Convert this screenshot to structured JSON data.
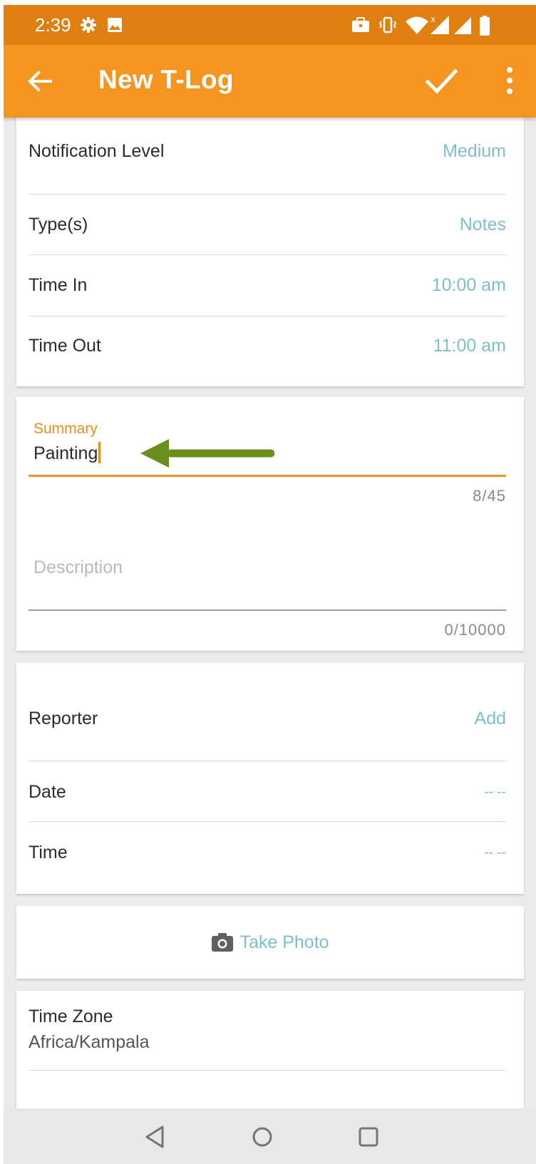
{
  "status_bar": {
    "time": "2:39",
    "icons": [
      "settings-icon",
      "image-icon",
      "briefcase-icon",
      "vibrate-icon",
      "wifi-icon",
      "signal-icon",
      "signal-icon",
      "battery-icon"
    ]
  },
  "app_bar": {
    "title": "New T-Log",
    "back_icon": "arrow-left-icon",
    "save_icon": "check-icon",
    "menu_icon": "more-vert-icon"
  },
  "details": [
    {
      "label": "Notification Level",
      "value": "Medium"
    },
    {
      "label": "Type(s)",
      "value": "Notes"
    },
    {
      "label": "Time In",
      "value": "10:00 am"
    },
    {
      "label": "Time Out",
      "value": "11:00 am"
    }
  ],
  "summary": {
    "label": "Summary",
    "value": "Painting",
    "counter": "8/45"
  },
  "description": {
    "placeholder": "Description",
    "counter": "0/10000"
  },
  "reporter_section": [
    {
      "label": "Reporter",
      "value": "Add"
    },
    {
      "label": "Date",
      "value": "-- --"
    },
    {
      "label": "Time",
      "value": "-- --"
    }
  ],
  "photo": {
    "label": "Take Photo",
    "icon": "camera-icon"
  },
  "timezone": {
    "label": "Time Zone",
    "value": "Africa/Kampala"
  },
  "annotation": {
    "icon": "green-arrow-icon",
    "color": "#6a8f1f"
  },
  "colors": {
    "status_bar": "#e07e10",
    "app_bar": "#f5941f",
    "accent": "#e5901d",
    "value_text": "#7dbfcb"
  },
  "nav_bar": {
    "icons": [
      "back-triangle-icon",
      "home-circle-icon",
      "recents-square-icon"
    ]
  }
}
